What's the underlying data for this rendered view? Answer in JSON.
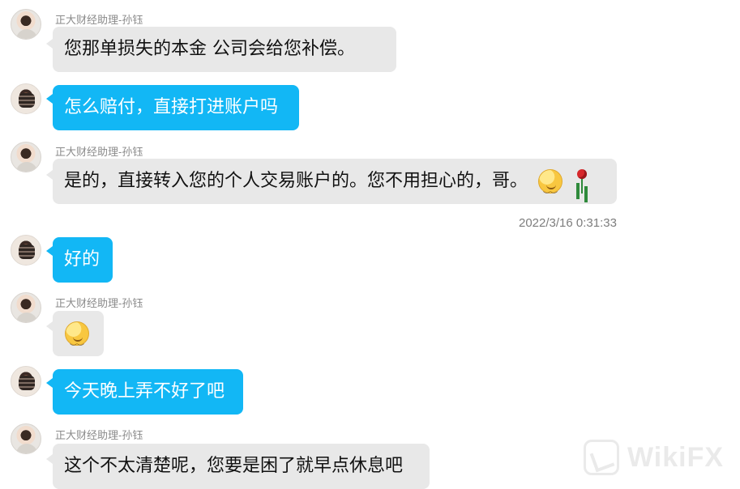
{
  "chat": {
    "assistant_name": "正大财经助理-孙钰",
    "timestamp": "2022/3/16 0:31:33",
    "messages": [
      {
        "sender": "assistant",
        "text": "您那单损失的本金     公司会给您补偿。"
      },
      {
        "sender": "me",
        "text": "怎么赔付，直接打进账户吗"
      },
      {
        "sender": "assistant",
        "text": "是的，直接转入您的个人交易账户的。您不用担心的，哥。",
        "emojis": [
          "smile-emoji",
          "rose-emoji"
        ]
      },
      {
        "sender": "me",
        "text": "好的"
      },
      {
        "sender": "assistant",
        "emojis": [
          "smile-emoji"
        ]
      },
      {
        "sender": "me",
        "text": "今天晚上弄不好了吧"
      },
      {
        "sender": "assistant",
        "text": "这个不太清楚呢，您要是困了就早点休息吧"
      }
    ]
  },
  "watermark": {
    "text": "WikiFX",
    "icon": "wikifx-logo-icon"
  },
  "colors": {
    "my_bubble": "#12b7f5",
    "other_bubble": "#e8e8e8",
    "sender_text": "#8a8a8a",
    "timestamp_text": "#7d7d7d"
  }
}
